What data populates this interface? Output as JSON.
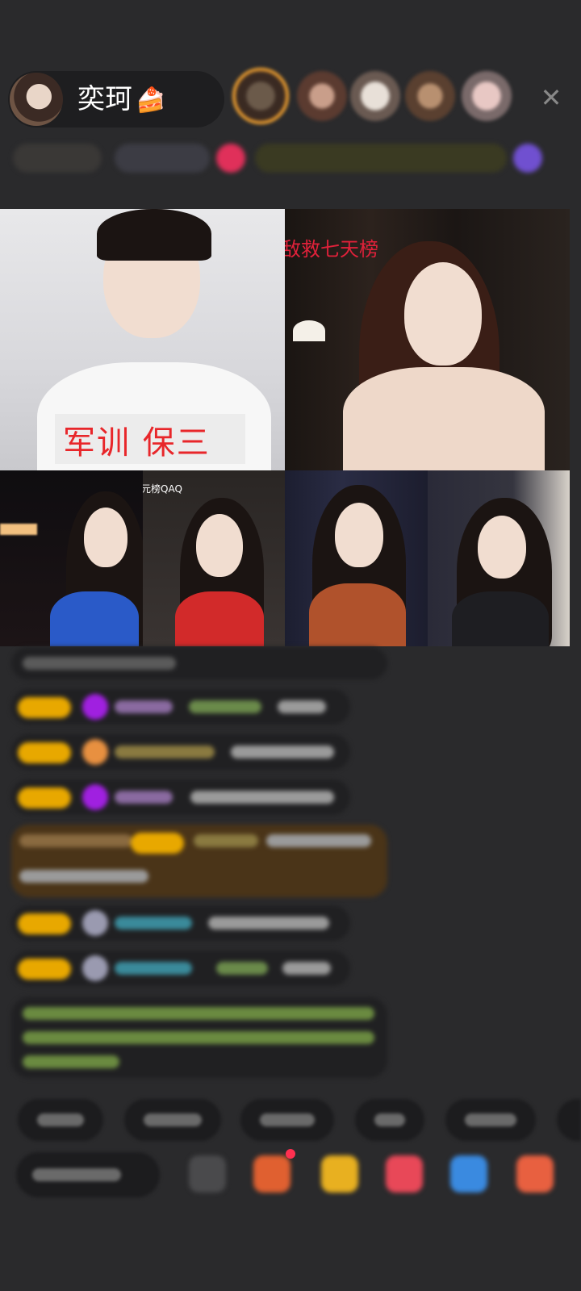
{
  "host": {
    "name": "奕珂",
    "name_icon": "cake-icon"
  },
  "header": {
    "close_icon": "close-icon",
    "viewer_ring_color": "#f0a030"
  },
  "video_grid": {
    "tiles": [
      {
        "caption": "军训 保三",
        "caption_color": "#e8262a"
      },
      {
        "caption": "敌救七天榜",
        "caption_color": "#e0213a"
      },
      {
        "caption": ""
      },
      {
        "caption": "元榜QAQ",
        "caption_color": "#ffffff"
      },
      {
        "caption": ""
      },
      {
        "caption": ""
      }
    ]
  },
  "colors": {
    "background": "#2a2a2c",
    "badge": "#e8a800",
    "accent_purple": "#a020e0"
  }
}
